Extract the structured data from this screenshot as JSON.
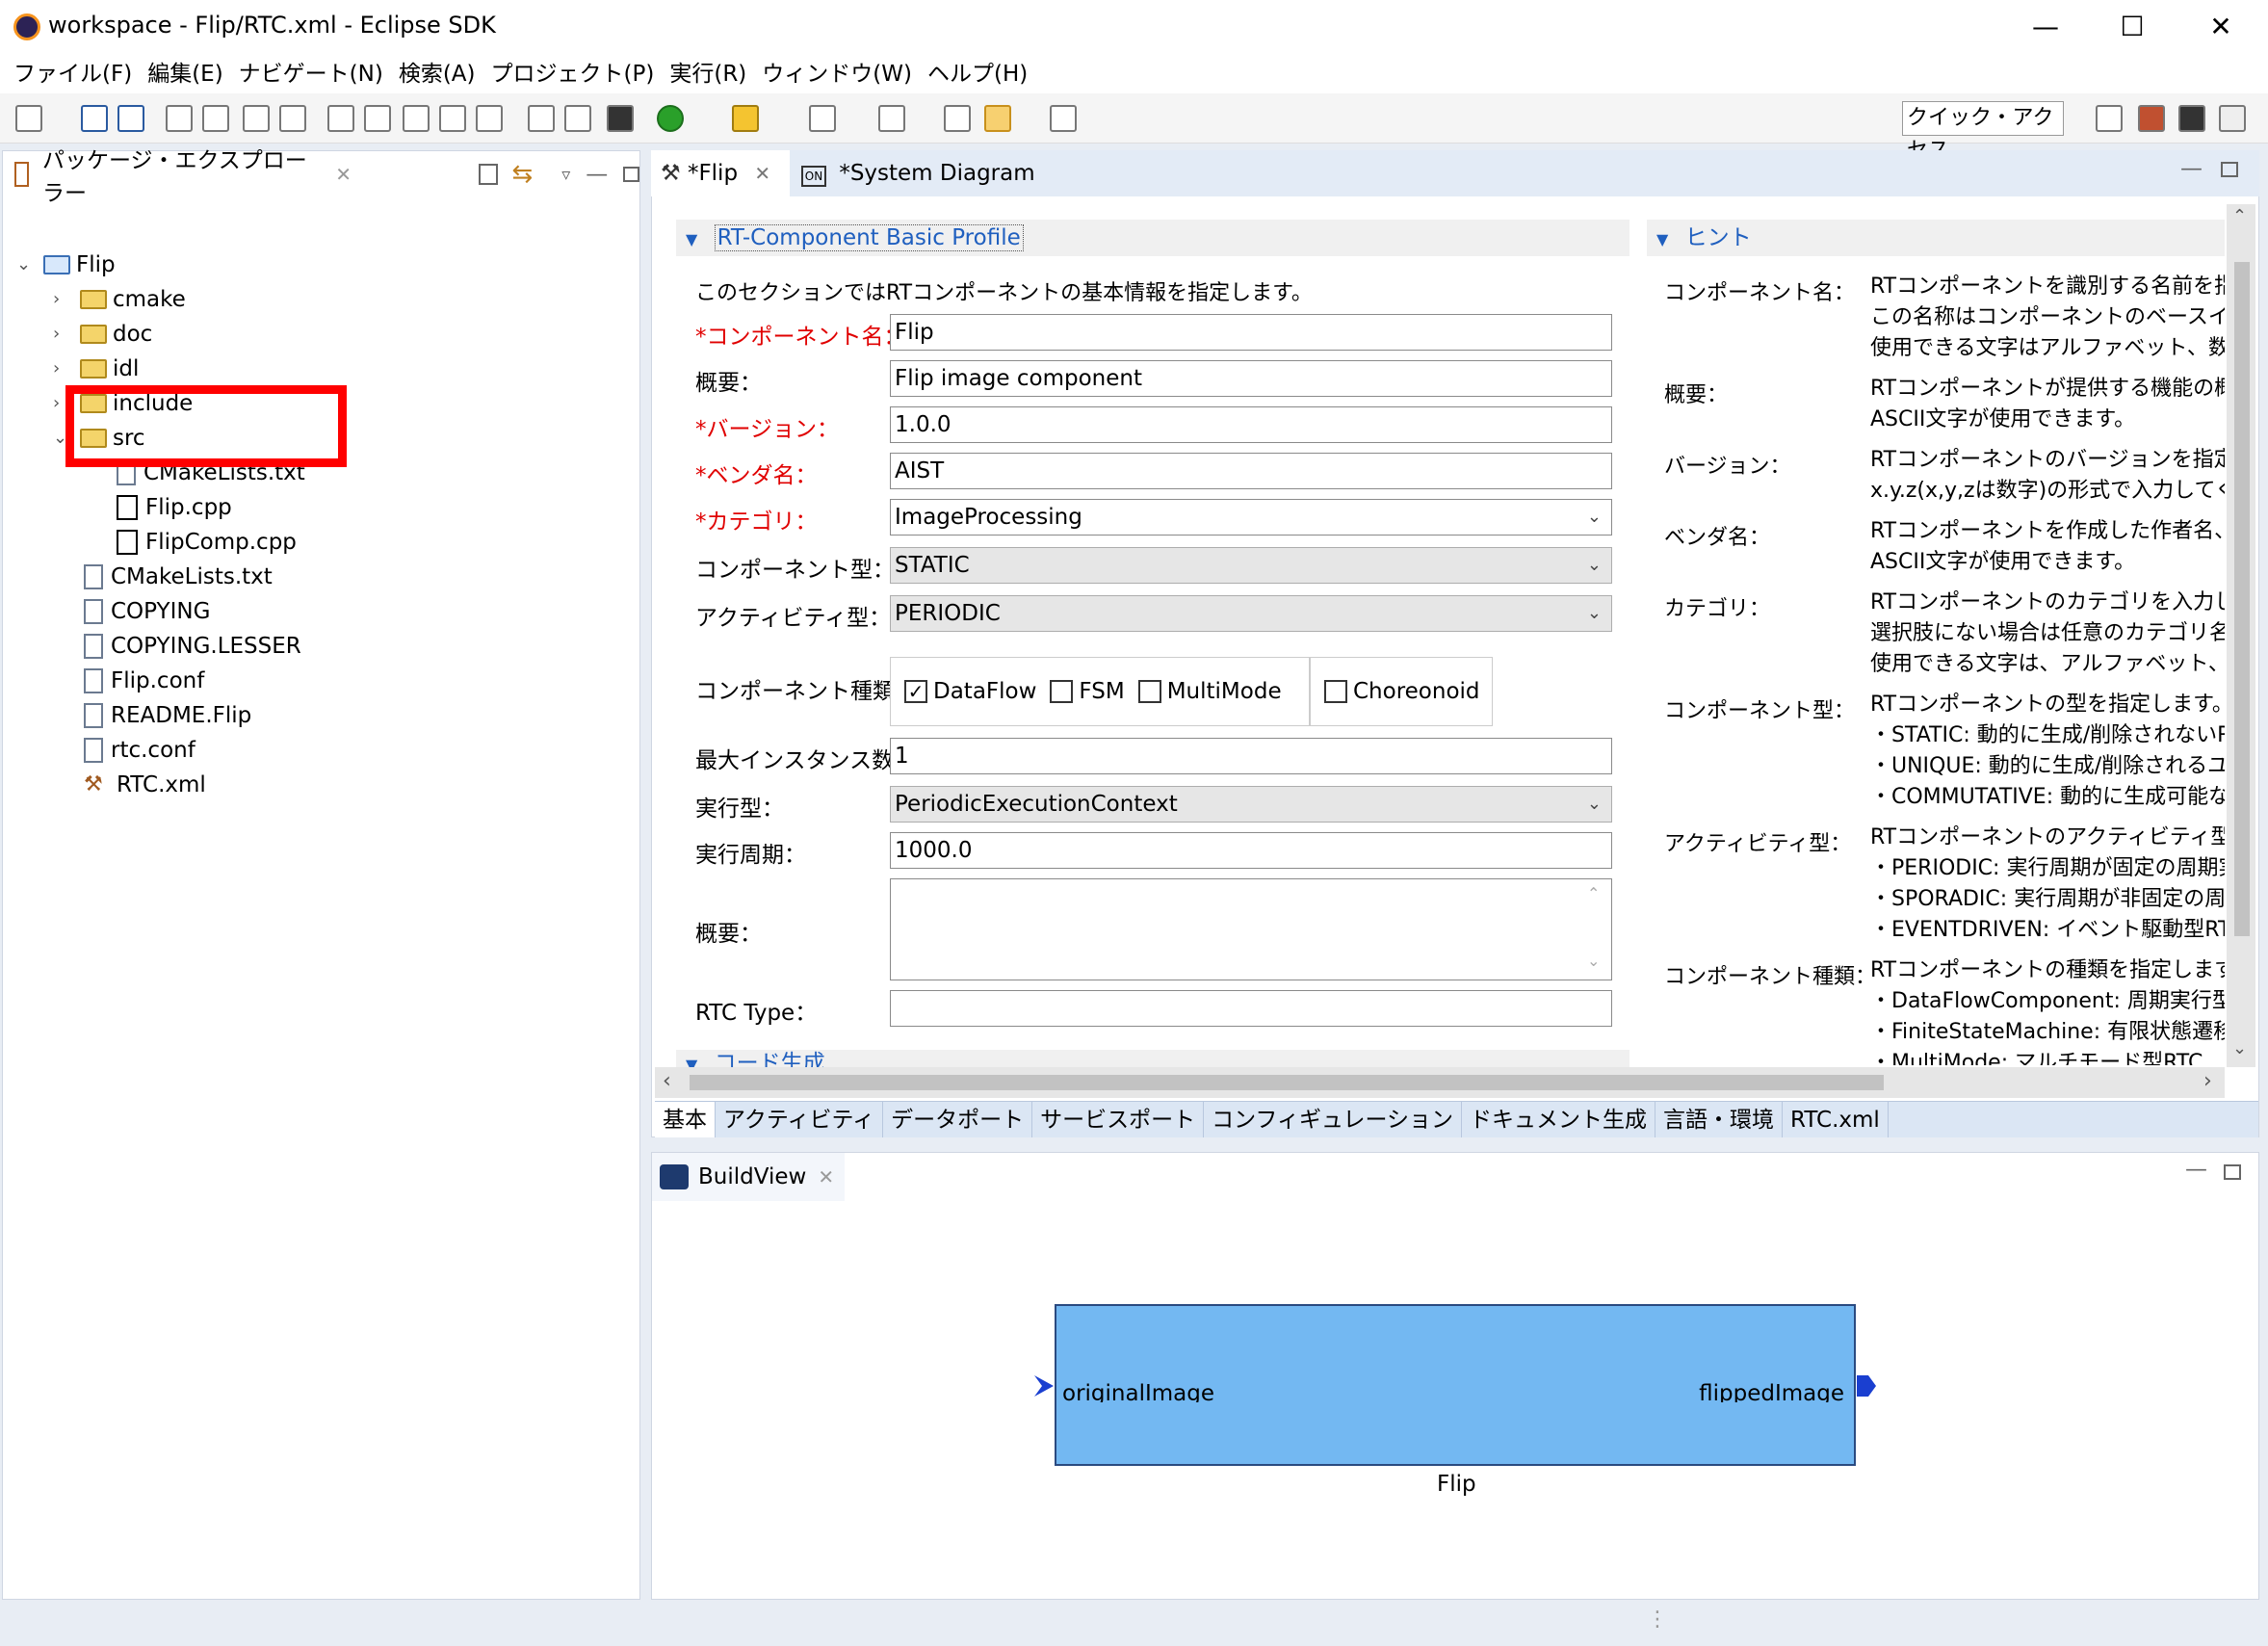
{
  "window": {
    "title": "workspace - Flip/RTC.xml - Eclipse SDK",
    "minimize": "—",
    "maximize": "☐",
    "close": "✕"
  },
  "menu": [
    "ファイル(F)",
    "編集(E)",
    "ナビゲート(N)",
    "検索(A)",
    "プロジェクト(P)",
    "実行(R)",
    "ウィンドウ(W)",
    "ヘルプ(H)"
  ],
  "toolbar": {
    "quick_access": "クイック・アクセス"
  },
  "explorer": {
    "title": "パッケージ・エクスプローラー",
    "tree": [
      {
        "label": "Flip",
        "level": 0,
        "type": "project",
        "expanded": true
      },
      {
        "label": "cmake",
        "level": 1,
        "type": "folder"
      },
      {
        "label": "doc",
        "level": 1,
        "type": "folder"
      },
      {
        "label": "idl",
        "level": 1,
        "type": "folder"
      },
      {
        "label": "include",
        "level": 1,
        "type": "folder"
      },
      {
        "label": "src",
        "level": 1,
        "type": "folder",
        "expanded": true
      },
      {
        "label": "CMakeLists.txt",
        "level": 2,
        "type": "file"
      },
      {
        "label": "Flip.cpp",
        "level": 2,
        "type": "cpp"
      },
      {
        "label": "FlipComp.cpp",
        "level": 2,
        "type": "cpp"
      },
      {
        "label": "CMakeLists.txt",
        "level": 1,
        "type": "file"
      },
      {
        "label": "COPYING",
        "level": 1,
        "type": "file"
      },
      {
        "label": "COPYING.LESSER",
        "level": 1,
        "type": "file"
      },
      {
        "label": "Flip.conf",
        "level": 1,
        "type": "file"
      },
      {
        "label": "README.Flip",
        "level": 1,
        "type": "file"
      },
      {
        "label": "rtc.conf",
        "level": 1,
        "type": "file"
      },
      {
        "label": "RTC.xml",
        "level": 1,
        "type": "hammer"
      }
    ]
  },
  "editor": {
    "tabs": [
      "*Flip",
      "*System Diagram"
    ],
    "section_title": "RT-Component Basic Profile",
    "section_desc": "このセクションではRTコンポーネントの基本情報を指定します。",
    "fields": {
      "component_name": {
        "label": "*コンポーネント名：",
        "value": "Flip"
      },
      "description": {
        "label": "概要：",
        "value": "Flip image component"
      },
      "version": {
        "label": "*バージョン：",
        "value": "1.0.0"
      },
      "vendor": {
        "label": "*ベンダ名：",
        "value": "AIST"
      },
      "category": {
        "label": "*カテゴリ：",
        "value": "ImageProcessing"
      },
      "component_type": {
        "label": "コンポーネント型：",
        "value": "STATIC"
      },
      "activity_type": {
        "label": "アクティビティ型：",
        "value": "PERIODIC"
      },
      "component_kind": {
        "label": "コンポーネント種類：",
        "options": [
          "DataFlow",
          "FSM",
          "MultiMode",
          "Choreonoid"
        ],
        "checked": "DataFlow"
      },
      "max_instances": {
        "label": "最大インスタンス数：",
        "value": "1"
      },
      "execution_type": {
        "label": "実行型：",
        "value": "PeriodicExecutionContext"
      },
      "execution_rate": {
        "label": "実行周期：",
        "value": "1000.0"
      },
      "abstract": {
        "label": "概要：",
        "value": ""
      },
      "rtc_type": {
        "label": "RTC Type：",
        "value": ""
      }
    },
    "next_section": "コード生成",
    "hint": {
      "title": "ヒント",
      "items": [
        {
          "label": "コンポーネント名：",
          "lines": [
            "RTコンポーネントを識別する名前を指定",
            "この名称はコンポーネントのベースインスタ",
            "使用できる文字はアルファベット、数字、"
          ]
        },
        {
          "label": "概要：",
          "lines": [
            "RTコンポーネントが提供する機能の概要",
            "ASCII文字が使用できます。"
          ]
        },
        {
          "label": "バージョン：",
          "lines": [
            "RTコンポーネントのバージョンを指定しま",
            "x.y.z(x,y,zは数字)の形式で入力してく"
          ]
        },
        {
          "label": "ベンダ名：",
          "lines": [
            "RTコンポーネントを作成した作者名、ベ",
            "ASCII文字が使用できます。"
          ]
        },
        {
          "label": "カテゴリ：",
          "lines": [
            "RTコンポーネントのカテゴリを入力します",
            "選択肢にない場合は任意のカテゴリ名",
            "使用できる文字は、アルファベット、数字"
          ]
        },
        {
          "label": "コンポーネント型：",
          "lines": [
            "RTコンポーネントの型を指定します。",
            "・STATIC: 動的に生成/削除されないR",
            "・UNIQUE: 動的に生成/削除されるユ",
            "・COMMUTATIVE: 動的に生成可能な"
          ]
        },
        {
          "label": "アクティビティ型：",
          "lines": [
            "RTコンポーネントのアクティビティ型を指定",
            "・PERIODIC: 実行周期が固定の周期実",
            "・SPORADIC: 実行周期が非固定の周",
            "・EVENTDRIVEN: イベント駆動型RTC"
          ]
        },
        {
          "label": "コンポーネント種類：",
          "lines": [
            "RTコンポーネントの種類を指定します。",
            "・DataFlowComponent: 周期実行型",
            "・FiniteStateMachine: 有限状態遷移",
            "・MultiMode: マルチモード型RTC"
          ]
        }
      ]
    },
    "bottom_tabs": [
      "基本",
      "アクティビティ",
      "データポート",
      "サービスポート",
      "コンフィギュレーション",
      "ドキュメント生成",
      "言語・環境",
      "RTC.xml"
    ]
  },
  "buildview": {
    "title": "BuildView",
    "component": {
      "name": "Flip",
      "in_port": "originalImage",
      "out_port": "flippedImage",
      "color": "#73b8f2"
    }
  }
}
